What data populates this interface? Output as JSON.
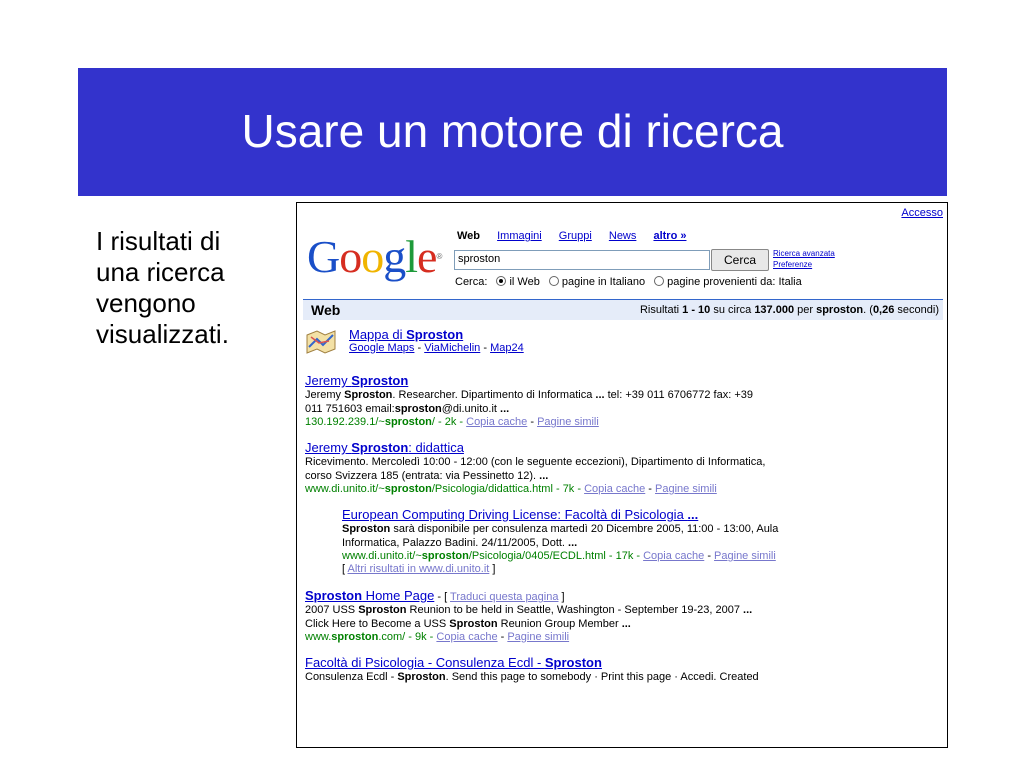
{
  "slide": {
    "title": "Usare un motore di ricerca",
    "side_text": [
      "I risultati di",
      "una ricerca",
      "vengono",
      "visualizzati."
    ],
    "title_bar_color": "#3333cc"
  },
  "google": {
    "accesso": "Accesso",
    "logo": {
      "g1": "G",
      "o1": "o",
      "o2": "o",
      "g2": "g",
      "l": "l",
      "e": "e",
      "tm": "®"
    },
    "tabs": {
      "web": "Web",
      "images": "Immagini",
      "groups": "Gruppi",
      "news": "News",
      "more": "altro »"
    },
    "search_value": "sproston",
    "search_button": "Cerca",
    "advanced": "Ricerca avanzata",
    "preferences": "Preferenze",
    "radio_label": "Cerca:",
    "radio_options": [
      "il Web",
      "pagine in Italiano",
      "pagine provenienti da: Italia"
    ],
    "web_label": "Web",
    "stats": {
      "prefix": "Risultati ",
      "range": "1 - 10",
      "mid": " su circa ",
      "count": "137.000",
      "per": " per ",
      "term": "sproston",
      "tail1": ". (",
      "time": "0,26",
      "tail2": " secondi)"
    },
    "map_result": {
      "title_pre": "Mappa di ",
      "title_term": "Sproston",
      "links": [
        "Google Maps",
        "ViaMichelin",
        "Map24"
      ],
      "sep": " - "
    },
    "results": [
      {
        "title_pre": "Jeremy ",
        "title_term": "Sproston",
        "title_post": "",
        "desc1_pre": "Jeremy ",
        "desc1_term": "Sproston",
        "desc1_post": ". Researcher. Dipartimento di Informatica ",
        "desc1_dots": "...",
        "desc1_tail": " tel: +39 011 6706772 fax: +39",
        "desc2_pre": "011 751603 email:",
        "desc2_term": "sproston",
        "desc2_post": "@di.unito.it ",
        "desc2_dots": "...",
        "url_pre": "130.192.239.1/~",
        "url_term": "sproston",
        "url_post": "/ - 2k - ",
        "cache": "Copia cache",
        "similar": "Pagine simili",
        "sep": " - "
      },
      {
        "title_pre": "Jeremy ",
        "title_term": "Sproston",
        "title_post": ": didattica",
        "desc1": "Ricevimento. Mercoledì 10:00 - 12:00 (con le seguente eccezioni), Dipartimento di Informatica,",
        "desc2_pre": "corso Svizzera 185 (entrata: via Pessinetto 12). ",
        "desc2_dots": "...",
        "url_pre": "www.di.unito.it/~",
        "url_term": "sproston",
        "url_post": "/Psicologia/didattica.html - 7k - ",
        "cache": "Copia cache",
        "similar": "Pagine simili",
        "sep": " - "
      },
      {
        "title": "European Computing Driving License: Facoltà di Psicologia ",
        "title_dots": "...",
        "desc1_term": "Sproston",
        "desc1_post": " sarà disponibile per consulenza martedì 20 Dicembre 2005, 11:00 - 13:00, Aula",
        "desc2_pre": "Informatica, Palazzo Badini. 24/11/2005, Dott. ",
        "desc2_dots": "...",
        "url_pre": "www.di.unito.it/~",
        "url_term": "sproston",
        "url_post": "/Psicologia/0405/ECDL.html - 17k - ",
        "cache": "Copia cache",
        "similar": "Pagine simili",
        "sep": " - ",
        "more_pre": "[ ",
        "more": "Altri risultati in www.di.unito.it",
        "more_post": " ]"
      },
      {
        "title_term": "Sproston",
        "title_post": " Home Page",
        "title_after": " - [ ",
        "translate": "Traduci questa pagina",
        "title_close": " ]",
        "desc1_pre": "2007 USS ",
        "desc1_term": "Sproston",
        "desc1_post": " Reunion to be held in Seattle, Washington - September 19-23, 2007 ",
        "desc1_dots": "...",
        "desc2_pre": "Click Here to Become a USS ",
        "desc2_term": "Sproston",
        "desc2_post": " Reunion Group Member ",
        "desc2_dots": "...",
        "url_pre": "www.",
        "url_term": "sproston",
        "url_post": ".com/ - 9k - ",
        "cache": "Copia cache",
        "similar": "Pagine simili",
        "sep": " - "
      },
      {
        "title_pre": "Facoltà di Psicologia - Consulenza Ecdl - ",
        "title_term": "Sproston",
        "desc1_pre": "Consulenza Ecdl - ",
        "desc1_term": "Sproston",
        "desc1_post": ". Send this page to somebody · Print this page · Accedi. Created"
      }
    ]
  }
}
